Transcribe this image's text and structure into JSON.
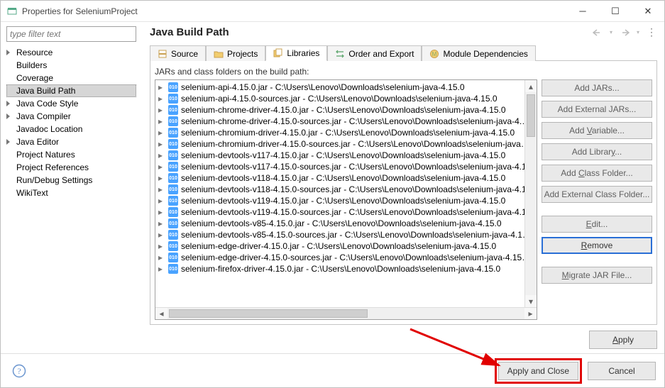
{
  "window": {
    "title": "Properties for SeleniumProject"
  },
  "filter": {
    "placeholder": "type filter text"
  },
  "sidebar": {
    "items": [
      {
        "label": "Resource",
        "exp": true
      },
      {
        "label": "Builders"
      },
      {
        "label": "Coverage"
      },
      {
        "label": "Java Build Path",
        "selected": true
      },
      {
        "label": "Java Code Style",
        "exp": true
      },
      {
        "label": "Java Compiler",
        "exp": true
      },
      {
        "label": "Javadoc Location"
      },
      {
        "label": "Java Editor",
        "exp": true
      },
      {
        "label": "Project Natures"
      },
      {
        "label": "Project References"
      },
      {
        "label": "Run/Debug Settings"
      },
      {
        "label": "WikiText"
      }
    ]
  },
  "page_title": "Java Build Path",
  "tabs": [
    {
      "label": "Source"
    },
    {
      "label": "Projects"
    },
    {
      "label": "Libraries",
      "active": true
    },
    {
      "label": "Order and Export"
    },
    {
      "label": "Module Dependencies"
    }
  ],
  "caption": "JARs and class folders on the build path:",
  "jars": [
    "selenium-api-4.15.0.jar - C:\\Users\\Lenovo\\Downloads\\selenium-java-4.15.0",
    "selenium-api-4.15.0-sources.jar - C:\\Users\\Lenovo\\Downloads\\selenium-java-4.15.0",
    "selenium-chrome-driver-4.15.0.jar - C:\\Users\\Lenovo\\Downloads\\selenium-java-4.15.0",
    "selenium-chrome-driver-4.15.0-sources.jar - C:\\Users\\Lenovo\\Downloads\\selenium-java-4.…",
    "selenium-chromium-driver-4.15.0.jar - C:\\Users\\Lenovo\\Downloads\\selenium-java-4.15.0",
    "selenium-chromium-driver-4.15.0-sources.jar - C:\\Users\\Lenovo\\Downloads\\selenium-java…",
    "selenium-devtools-v117-4.15.0.jar - C:\\Users\\Lenovo\\Downloads\\selenium-java-4.15.0",
    "selenium-devtools-v117-4.15.0-sources.jar - C:\\Users\\Lenovo\\Downloads\\selenium-java-4.1…",
    "selenium-devtools-v118-4.15.0.jar - C:\\Users\\Lenovo\\Downloads\\selenium-java-4.15.0",
    "selenium-devtools-v118-4.15.0-sources.jar - C:\\Users\\Lenovo\\Downloads\\selenium-java-4.1…",
    "selenium-devtools-v119-4.15.0.jar - C:\\Users\\Lenovo\\Downloads\\selenium-java-4.15.0",
    "selenium-devtools-v119-4.15.0-sources.jar - C:\\Users\\Lenovo\\Downloads\\selenium-java-4.1…",
    "selenium-devtools-v85-4.15.0.jar - C:\\Users\\Lenovo\\Downloads\\selenium-java-4.15.0",
    "selenium-devtools-v85-4.15.0-sources.jar - C:\\Users\\Lenovo\\Downloads\\selenium-java-4.1…",
    "selenium-edge-driver-4.15.0.jar - C:\\Users\\Lenovo\\Downloads\\selenium-java-4.15.0",
    "selenium-edge-driver-4.15.0-sources.jar - C:\\Users\\Lenovo\\Downloads\\selenium-java-4.15…",
    "selenium-firefox-driver-4.15.0.jar - C:\\Users\\Lenovo\\Downloads\\selenium-java-4.15.0"
  ],
  "buttons": {
    "add_jars": "Add JARs...",
    "add_ext_jars": "Add External JARs...",
    "add_var": "Add Variable...",
    "add_lib": "Add Library...",
    "add_class": "Add Class Folder...",
    "add_ext_class": "Add External Class Folder...",
    "edit": "Edit...",
    "remove": "Remove",
    "migrate": "Migrate JAR File..."
  },
  "footer": {
    "apply": "Apply",
    "apply_close": "Apply and Close",
    "cancel": "Cancel"
  }
}
